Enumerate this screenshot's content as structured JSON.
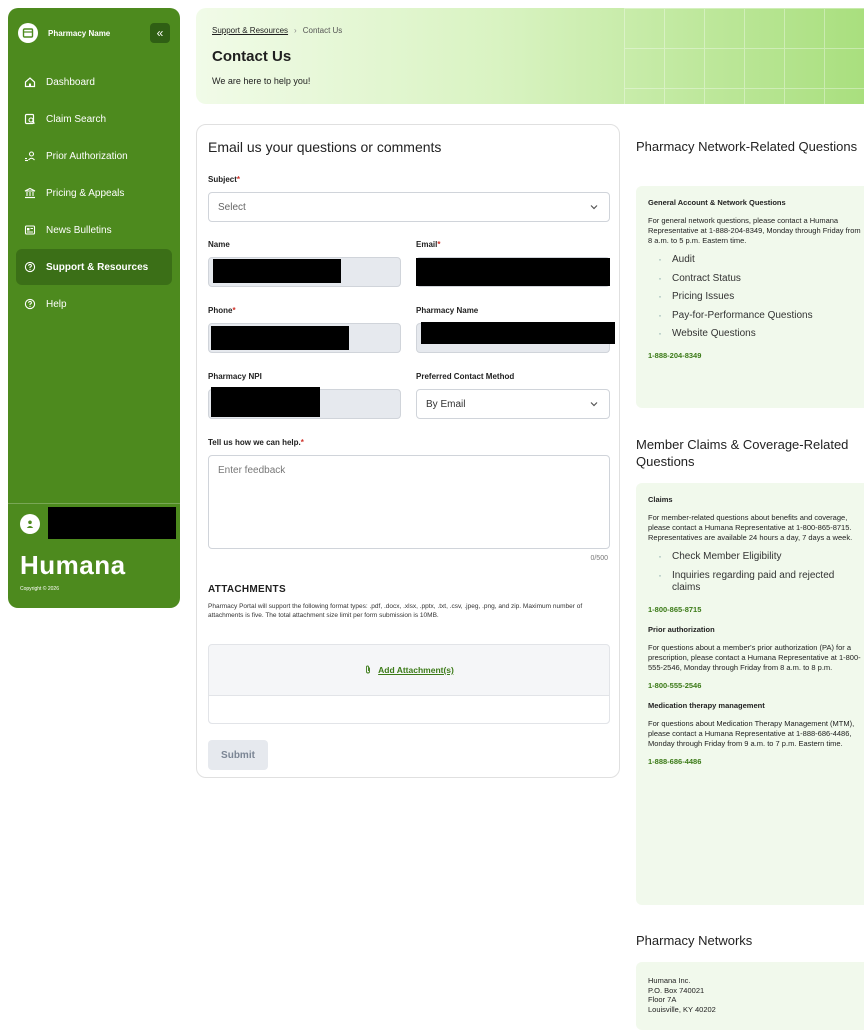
{
  "sidebar": {
    "app_name": "Pharmacy Name",
    "collapse_glyph": "«",
    "items": [
      {
        "label": "Dashboard",
        "icon": "home-icon"
      },
      {
        "label": "Claim Search",
        "icon": "claim-search-icon"
      },
      {
        "label": "Prior Authorization",
        "icon": "prior-authorization-icon"
      },
      {
        "label": "Pricing & Appeals",
        "icon": "bank-icon"
      },
      {
        "label": "News Bulletins",
        "icon": "newspaper-icon"
      },
      {
        "label": "Support & Resources",
        "icon": "help-circle-icon",
        "active": true
      },
      {
        "label": "Help",
        "icon": "help-circle-icon"
      }
    ],
    "brand": "Humana",
    "copyright": "Copyright © 2026"
  },
  "header": {
    "breadcrumb_parent": "Support & Resources",
    "breadcrumb_separator": "›",
    "breadcrumb_current": "Contact Us",
    "title": "Contact Us",
    "subtitle": "We are here to help you!"
  },
  "form": {
    "heading": "Email us your questions or comments",
    "subject_label": "Subject",
    "subject_value": "Select",
    "name_label": "Name",
    "email_label": "Email",
    "phone_label": "Phone",
    "pharmacy_name_label": "Pharmacy Name",
    "npi_label": "Pharmacy NPI",
    "contact_method_label": "Preferred Contact Method",
    "contact_method_value": "By Email",
    "help_label": "Tell us how we can help.",
    "help_placeholder": "Enter feedback",
    "counter": "0/500",
    "required_mark": "*",
    "attachments_title": "ATTACHMENTS",
    "attachments_note": "Pharmacy Portal will support the following format types: .pdf, .docx, .xlsx, .pptx, .txt, .csv, .jpeg, .png, and zip. Maximum number of attachments is five. The total attachment size limit per form submission is 10MB.",
    "add_attachment": "Add Attachment(s)",
    "submit": "Submit"
  },
  "network": {
    "title": "Pharmacy Network-Related Questions",
    "card_title": "General Account & Network Questions",
    "card_text": "For general network questions, please contact a Humana Representative at 1-888-204-8349, Monday through Friday from 8 a.m. to 5 p.m. Eastern time.",
    "items": [
      "Audit",
      "Contract Status",
      "Pricing Issues",
      "Pay-for-Performance Questions",
      "Website Questions"
    ],
    "phone": "1-888-204-8349"
  },
  "member": {
    "title": "Member Claims & Coverage-Related Questions",
    "claims_title": "Claims",
    "claims_text": "For member-related questions about benefits and coverage, please contact a Humana Representative at 1-800-865-8715. Representatives are available 24 hours a day, 7 days a week.",
    "claims_items": [
      "Check Member Eligibility",
      "Inquiries regarding paid and rejected claims"
    ],
    "claims_phone": "1-800-865-8715",
    "pa_title": "Prior authorization",
    "pa_text": "For questions about a member's prior authorization (PA) for a prescription, please contact a Humana Representative at 1-800-555-2546, Monday through Friday from 8 a.m. to 8 p.m.",
    "pa_phone": "1-800-555-2546",
    "mtm_title": "Medication therapy management",
    "mtm_text": "For questions about Medication Therapy Management (MTM), please contact a Humana Representative at 1-888-686-4486, Monday through Friday from 9 a.m. to 7 p.m. Eastern time.",
    "mtm_phone": "1-888-686-4486"
  },
  "networks": {
    "title": "Pharmacy Networks",
    "address": [
      "Humana Inc.",
      "P.O. Box 740021",
      "Floor 7A",
      "Louisville, KY 40202"
    ]
  },
  "colors": {
    "sidebar": "#4d8a1e",
    "sidebar_active": "#3b6f17",
    "accent_link": "#3b7a17",
    "required": "#d0342c",
    "info_bg": "#f1f9ec"
  }
}
